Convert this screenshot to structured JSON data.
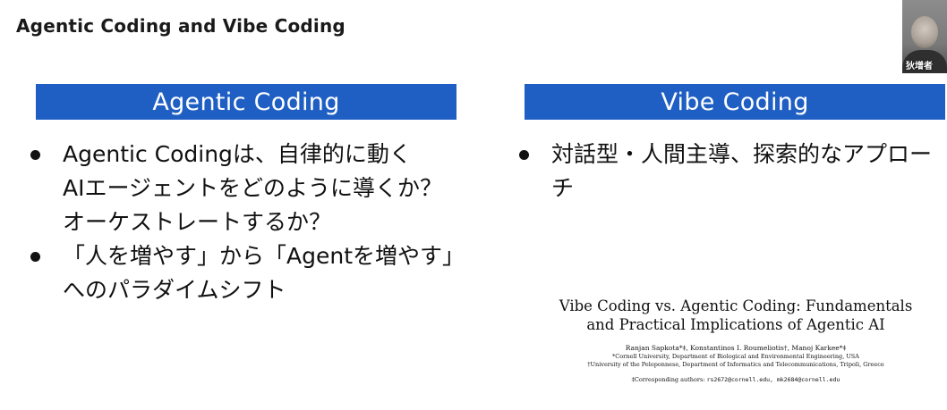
{
  "slide": {
    "title": "Agentic Coding and Vibe Coding"
  },
  "webcam": {
    "name": "狄增者"
  },
  "left_column": {
    "header": "Agentic Coding",
    "bullets": [
      {
        "lines": [
          "Agentic Codingは、自律的に動く",
          "AIエージェントをどのように導くか？",
          "オーケストレートするか？"
        ]
      },
      {
        "lines": [
          "「人を増やす」から「Agentを増やす」",
          "へのパラダイムシフト"
        ]
      }
    ]
  },
  "right_column": {
    "header": "Vibe Coding",
    "bullets": [
      {
        "lines": [
          "対話型・人間主導、探索的なアプロー",
          "チ"
        ]
      }
    ]
  },
  "paper": {
    "title_line1": "Vibe Coding vs. Agentic Coding: Fundamentals",
    "title_line2": "and Practical Implications of Agentic AI",
    "authors": "Ranjan Sapkota*‡, Konstantinos I. Roumeliotis†, Manoj Karkee*‡",
    "affiliation1": "*Cornell University, Department of Biological and Environmental Engineering, USA",
    "affiliation2": "†University of the Peloponnese, Department of Informatics and Telecommunications, Tripoli, Greece",
    "corresponding_label": "‡Corresponding authors: ",
    "corresponding_emails": "rs2672@cornell.edu, mk2684@cornell.edu"
  },
  "colors": {
    "header_blue": "#1f5fc4",
    "text": "#111111",
    "background": "#ffffff"
  },
  "icons": {
    "bullet": "bullet-dot-icon"
  }
}
